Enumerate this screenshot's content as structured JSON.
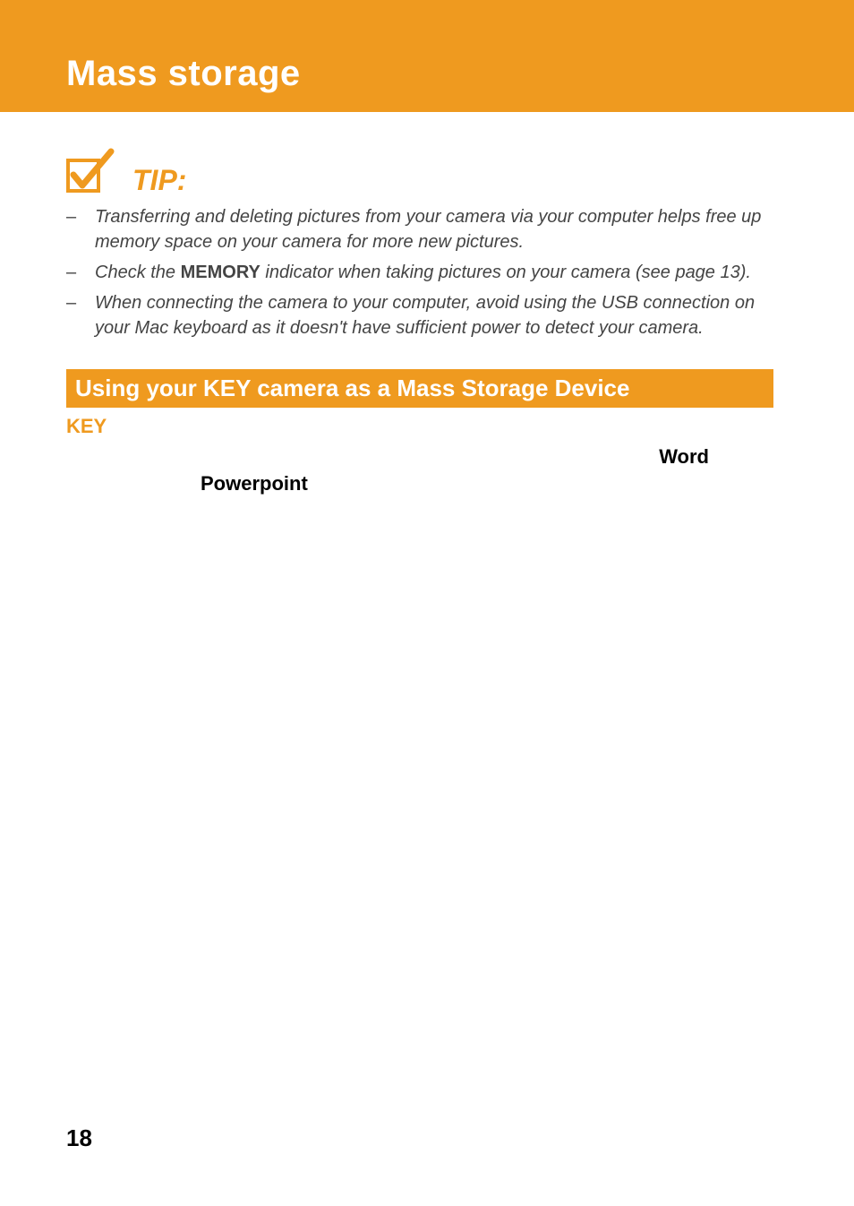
{
  "header": {
    "title": "Mass storage"
  },
  "tip": {
    "label": "TIP:",
    "items": [
      {
        "dash": "–",
        "pre": "Transferring and deleting pictures from your camera via your computer helps free up memory space on your camera for more new pictures."
      },
      {
        "dash": "–",
        "pre": "Check the ",
        "bold": "MEMORY",
        "post": " indicator when taking pictures on your camera (see page 13)."
      },
      {
        "dash": "–",
        "pre": "When connecting the camera to your computer, avoid using the USB connection on your Mac keyboard as it doesn't have sufficient power to detect your camera."
      }
    ]
  },
  "section": {
    "title": "Using your KEY camera as a Mass Storage Device",
    "key_label": "KEY",
    "word": "Word",
    "powerpoint": "Powerpoint"
  },
  "page_number": "18"
}
